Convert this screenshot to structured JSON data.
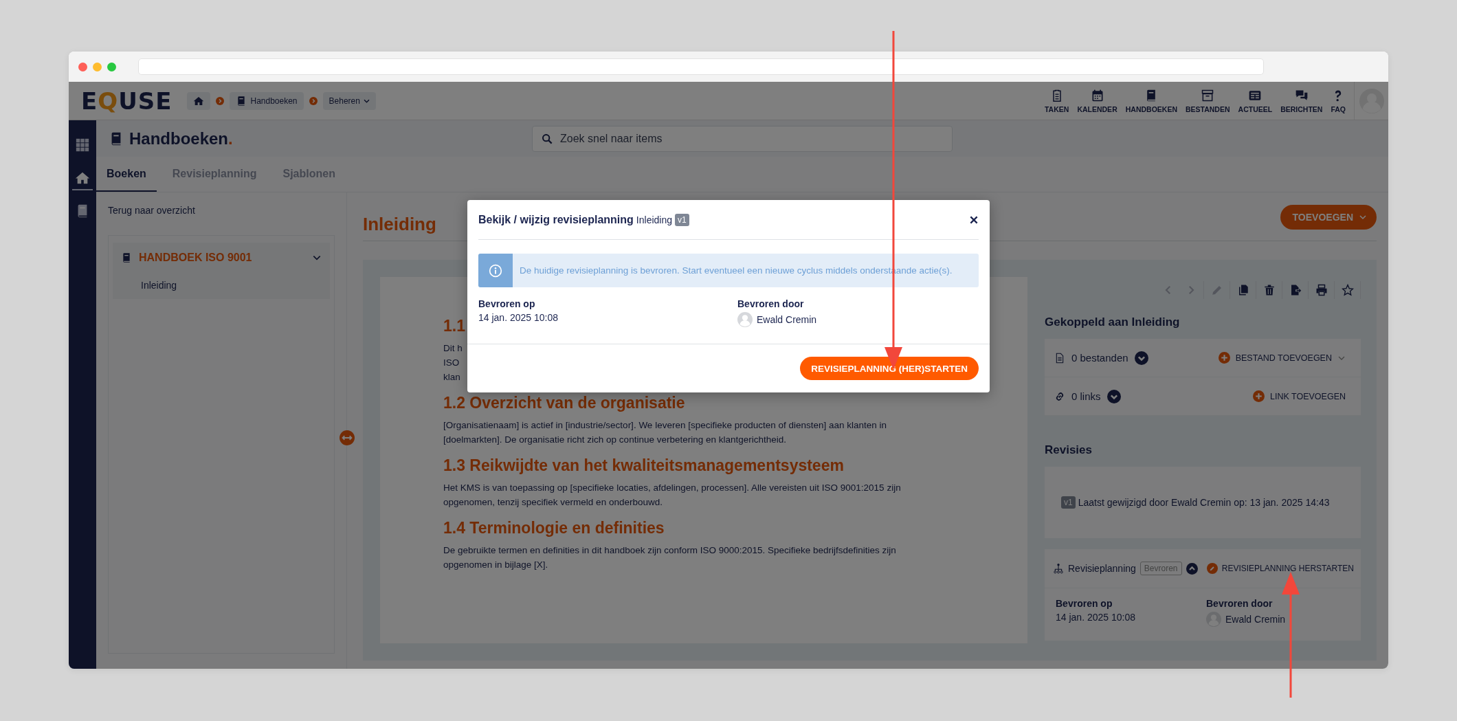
{
  "header": {
    "logo": [
      {
        "text": "E",
        "accent": false
      },
      {
        "text": "Q",
        "accent": true
      },
      {
        "text": "USE",
        "accent": false
      }
    ],
    "breadcrumbs": [
      {
        "kind": "home"
      },
      {
        "kind": "link",
        "label": "Handboeken"
      },
      {
        "kind": "dropdown",
        "label": "Beheren"
      }
    ],
    "nav": [
      {
        "kind": "tasks",
        "label": "TAKEN"
      },
      {
        "kind": "calendar",
        "label": "KALENDER"
      },
      {
        "kind": "book",
        "label": "HANDBOEKEN"
      },
      {
        "kind": "archive",
        "label": "BESTANDEN"
      },
      {
        "kind": "news",
        "label": "ACTUEEL"
      },
      {
        "kind": "chat",
        "label": "BERICHTEN"
      },
      {
        "kind": "help",
        "label": "FAQ"
      }
    ]
  },
  "sidebar": {
    "items": [
      {
        "kind": "apps",
        "selected": false
      },
      {
        "kind": "home",
        "selected": true
      },
      {
        "kind": "book",
        "selected": false
      }
    ]
  },
  "page": {
    "title": "Handboeken",
    "title_suffix": ".",
    "search": {
      "placeholder": "Zoek snel naar items"
    },
    "tabs": [
      {
        "label": "Boeken",
        "selected": true
      },
      {
        "label": "Revisieplanning",
        "selected": false
      },
      {
        "label": "Sjablonen",
        "selected": false
      }
    ]
  },
  "back_link": "Terug naar overzicht",
  "tree": [
    {
      "label": "HANDBOEK ISO 9001",
      "expanded": true,
      "children": [
        {
          "label": "Inleiding"
        }
      ]
    }
  ],
  "article": {
    "title": "Inleiding",
    "add_button": "TOEVOEGEN",
    "sections": [
      {
        "heading": "1.1",
        "lines": [
          "Dit h",
          "ISO",
          "klan"
        ]
      },
      {
        "heading": "1.2 Overzicht van de organisatie",
        "body": "[Organisatienaam] is actief in [industrie/sector]. We leveren [specifieke producten of diensten] aan klanten in [doelmarkten]. De organisatie richt zich op continue verbetering en klantgerichtheid."
      },
      {
        "heading": "1.3 Reikwijdte van het kwaliteitsmanagementsysteem",
        "body": "Het KMS is van toepassing op [specifieke locaties, afdelingen, processen]. Alle vereisten uit ISO 9001:2015 zijn opgenomen, tenzij specifiek vermeld en onderbouwd."
      },
      {
        "heading": "1.4 Terminologie en definities",
        "body": "De gebruikte termen en definities in dit handboek zijn conform ISO 9000:2015. Specifieke bedrijfsdefinities zijn opgenomen in bijlage [X]."
      }
    ]
  },
  "toolbar": [
    {
      "kind": "prev",
      "disabled": true
    },
    {
      "kind": "next",
      "disabled": true
    },
    {
      "kind": "edit",
      "disabled": true
    },
    {
      "kind": "copy",
      "disabled": false
    },
    {
      "kind": "delete",
      "disabled": false
    },
    {
      "kind": "export",
      "disabled": false
    },
    {
      "kind": "print",
      "disabled": false
    },
    {
      "kind": "favorite",
      "disabled": false
    }
  ],
  "linked": {
    "title": "Gekoppeld aan Inleiding",
    "rows": [
      {
        "kind": "files",
        "count": "0 bestanden",
        "action": "BESTAND TOEVOEGEN",
        "dropdown": true
      },
      {
        "kind": "links",
        "count": "0 links",
        "action": "LINK TOEVOEGEN",
        "dropdown": false
      }
    ]
  },
  "revisions": {
    "title": "Revisies",
    "version": "v1",
    "text": "Laatst gewijzigd door Ewald Cremin op: 13 jan. 2025 14:43",
    "planning": {
      "label": "Revisieplanning",
      "status": "Bevroren",
      "expanded": true,
      "action": "REVISIEPLANNING HERSTARTEN",
      "fields": [
        {
          "kind": "text",
          "label": "Bevroren op",
          "value": "14 jan. 2025 10:08"
        },
        {
          "kind": "user",
          "label": "Bevroren door",
          "value": "Ewald Cremin"
        }
      ]
    }
  },
  "modal": {
    "title": "Bekijk / wijzig revisieplanning",
    "subtitle": "Inleiding",
    "version": "v1",
    "alert": "De huidige revisieplanning is bevroren. Start eventueel een nieuwe cyclus middels onderstaande actie(s).",
    "fields": [
      {
        "kind": "text",
        "label": "Bevroren op",
        "value": "14 jan. 2025 10:08"
      },
      {
        "kind": "user",
        "label": "Bevroren door",
        "value": "Ewald Cremin"
      }
    ],
    "button": "REVISIEPLANNING (HER)STARTEN"
  }
}
